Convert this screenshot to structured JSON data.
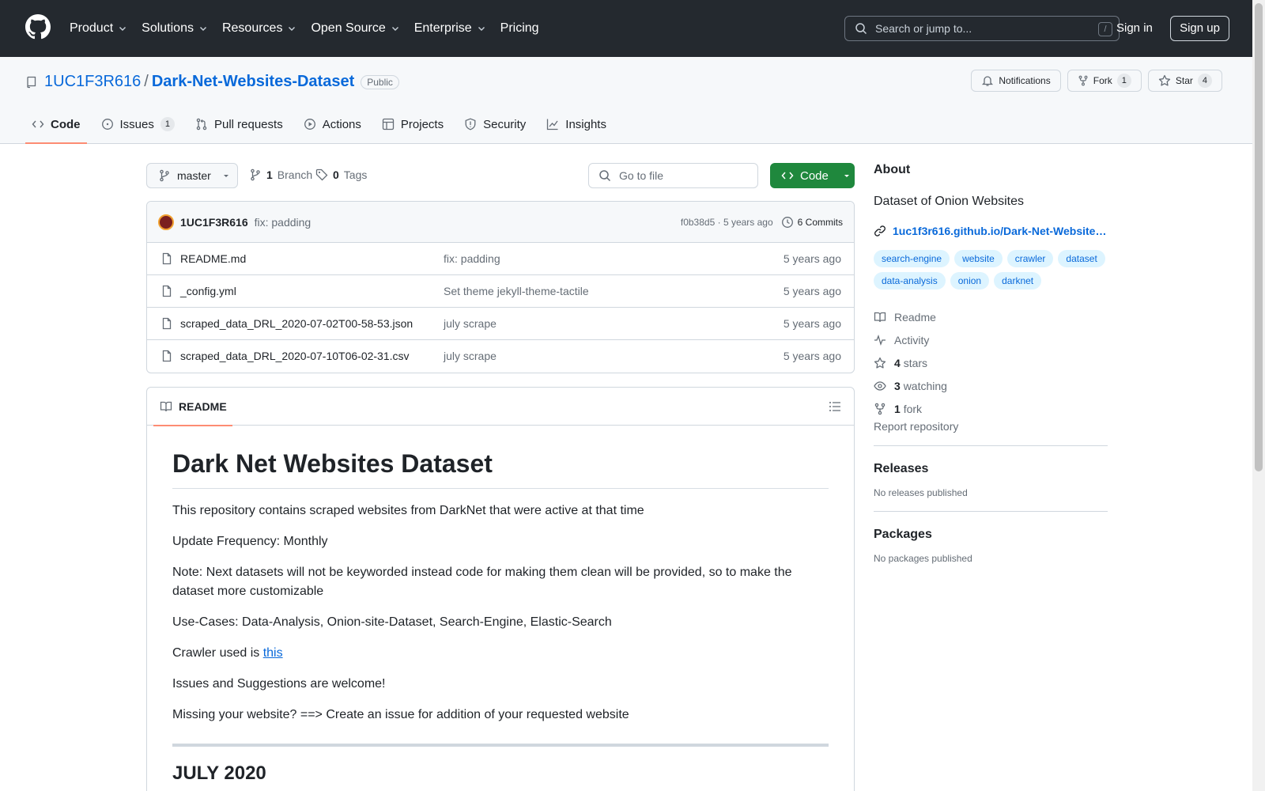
{
  "header": {
    "nav": [
      "Product",
      "Solutions",
      "Resources",
      "Open Source",
      "Enterprise",
      "Pricing"
    ],
    "search_placeholder": "Search or jump to...",
    "search_key": "/",
    "sign_in": "Sign in",
    "sign_up": "Sign up"
  },
  "repo": {
    "owner": "1UC1F3R616",
    "separator": "/",
    "name": "Dark-Net-Websites-Dataset",
    "visibility": "Public",
    "notifications_label": "Notifications",
    "fork_label": "Fork",
    "fork_count": "1",
    "star_label": "Star",
    "star_count": "4"
  },
  "tabs": [
    {
      "label": "Code"
    },
    {
      "label": "Issues",
      "count": "1"
    },
    {
      "label": "Pull requests"
    },
    {
      "label": "Actions"
    },
    {
      "label": "Projects"
    },
    {
      "label": "Security"
    },
    {
      "label": "Insights"
    }
  ],
  "toolbar": {
    "branch": "master",
    "branch_count": "1",
    "branch_label": "Branch",
    "tag_count": "0",
    "tag_label": "Tags",
    "goto_placeholder": "Go to file",
    "code_label": "Code"
  },
  "commit": {
    "author": "1UC1F3R616",
    "message": "fix: padding",
    "hash": "f0b38d5",
    "age": "· 5 years ago",
    "commits_label": "6 Commits"
  },
  "files": [
    {
      "name": "README.md",
      "message": "fix: padding",
      "date": "5 years ago"
    },
    {
      "name": "_config.yml",
      "message": "Set theme jekyll-theme-tactile",
      "date": "5 years ago"
    },
    {
      "name": "scraped_data_DRL_2020-07-02T00-58-53.json",
      "message": "july scrape",
      "date": "5 years ago"
    },
    {
      "name": "scraped_data_DRL_2020-07-10T06-02-31.csv",
      "message": "july scrape",
      "date": "5 years ago"
    }
  ],
  "readme": {
    "tab_label": "README",
    "title": "Dark Net Websites Dataset",
    "p1": "This repository contains scraped websites from DarkNet that were active at that time",
    "p2": "Update Frequency: Monthly",
    "p3": "Note: Next datasets will not be keyworded instead code for making them clean will be provided, so to make the dataset more customizable",
    "p4": "Use-Cases: Data-Analysis, Onion-site-Dataset, Search-Engine, Elastic-Search",
    "p5_prefix": "Crawler used is ",
    "p5_link": "this",
    "p6": "Issues and Suggestions are welcome!",
    "p7": "Missing your website? ==> Create an issue for addition of your requested website",
    "h2": "JULY 2020"
  },
  "about": {
    "heading": "About",
    "description": "Dataset of Onion Websites",
    "link": "1uc1f3r616.github.io/Dark-Net-Website…",
    "topics": [
      "search-engine",
      "website",
      "crawler",
      "dataset",
      "data-analysis",
      "onion",
      "darknet"
    ],
    "readme": "Readme",
    "activity": "Activity",
    "stars_count": "4",
    "stars_label": "stars",
    "watching_count": "3",
    "watching_label": "watching",
    "fork_count": "1",
    "fork_label": "fork",
    "report": "Report repository"
  },
  "releases": {
    "heading": "Releases",
    "empty": "No releases published"
  },
  "packages": {
    "heading": "Packages",
    "empty": "No packages published"
  }
}
